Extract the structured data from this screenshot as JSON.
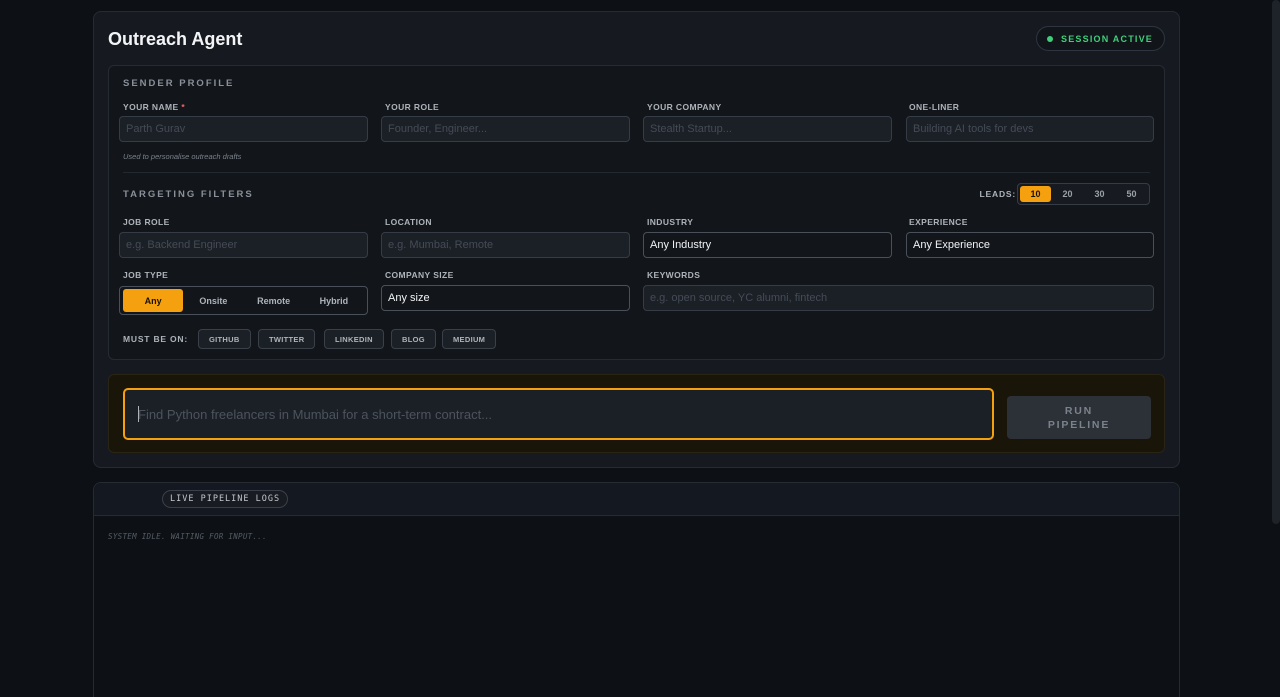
{
  "app": {
    "title": "Outreach Agent",
    "session_badge": "SESSION ACTIVE"
  },
  "sender_profile": {
    "section_title": "SENDER PROFILE",
    "name_label": "YOUR NAME",
    "name_required": "*",
    "name_placeholder": "Parth Gurav",
    "name_helper": "Used to personalise outreach drafts",
    "role_label": "YOUR ROLE",
    "role_placeholder": "Founder, Engineer...",
    "company_label": "YOUR COMPANY",
    "company_placeholder": "Stealth Startup...",
    "oneliner_label": "ONE-LINER",
    "oneliner_placeholder": "Building AI tools for devs"
  },
  "targeting": {
    "section_title": "TARGETING FILTERS",
    "leads_label": "LEADS:",
    "leads_options": [
      "10",
      "20",
      "30",
      "50"
    ],
    "leads_selected": "10",
    "job_role_label": "JOB ROLE",
    "job_role_placeholder": "e.g. Backend Engineer",
    "location_label": "LOCATION",
    "location_placeholder": "e.g. Mumbai, Remote",
    "industry_label": "INDUSTRY",
    "industry_value": "Any Industry",
    "experience_label": "EXPERIENCE",
    "experience_value": "Any Experience",
    "job_type_label": "JOB TYPE",
    "job_type_options": [
      "Any",
      "Onsite",
      "Remote",
      "Hybrid"
    ],
    "job_type_selected": "Any",
    "company_size_label": "COMPANY SIZE",
    "company_size_value": "Any size",
    "keywords_label": "KEYWORDS",
    "keywords_placeholder": "e.g. open source, YC alumni, fintech",
    "must_be_on_label": "MUST BE ON:",
    "platforms": [
      "GITHUB",
      "TWITTER",
      "LINKEDIN",
      "BLOG",
      "MEDIUM"
    ]
  },
  "prompt": {
    "placeholder": "Find Python freelancers in Mumbai for a short-term contract...",
    "run_label_line1": "RUN",
    "run_label_line2": "PIPELINE"
  },
  "logs": {
    "tab_label": "LIVE PIPELINE LOGS",
    "idle_text": "SYSTEM IDLE. WAITING FOR INPUT..."
  },
  "colors": {
    "accent": "#f5a00f",
    "status_green": "#3fcf7a",
    "required_red": "#f56565",
    "background": "#0d1015"
  }
}
